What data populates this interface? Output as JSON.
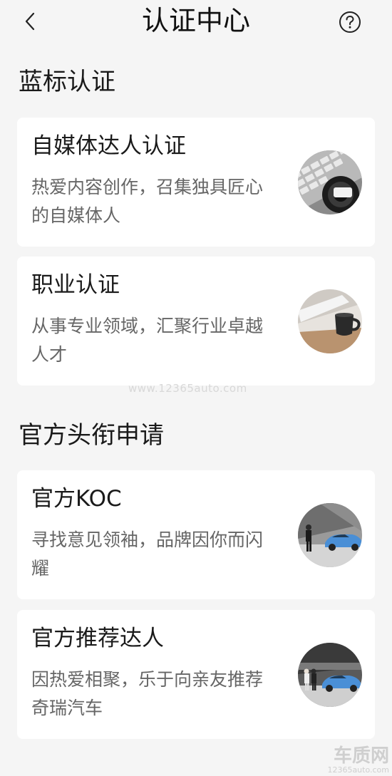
{
  "header": {
    "title": "认证中心",
    "back_icon": "chevron-left-icon",
    "help_icon": "question-circle-icon"
  },
  "sections": [
    {
      "title": "蓝标认证",
      "cards": [
        {
          "title": "自媒体达人认证",
          "desc": "热爱内容创作，召集独具匠心的自媒体人",
          "image": "keyboard-camera-photo"
        },
        {
          "title": "职业认证",
          "desc": "从事专业领域，汇聚行业卓越人才",
          "image": "laptop-mug-photo"
        }
      ]
    },
    {
      "title": "官方头衔申请",
      "cards": [
        {
          "title": "官方KOC",
          "desc": "寻找意见领袖，品牌因你而闪耀",
          "image": "man-with-car-photo"
        },
        {
          "title": "官方推荐达人",
          "desc": "因热爱相聚，乐于向亲友推荐奇瑞汽车",
          "image": "people-with-car-photo"
        }
      ]
    }
  ],
  "watermark": "www.12365auto.com",
  "corner_mark": {
    "big": "车质网",
    "small": "12365auto.com"
  },
  "colors": {
    "background": "#f5f5f5",
    "card": "#ffffff",
    "desc_text": "#666666",
    "title_text": "#1a1a1a"
  }
}
